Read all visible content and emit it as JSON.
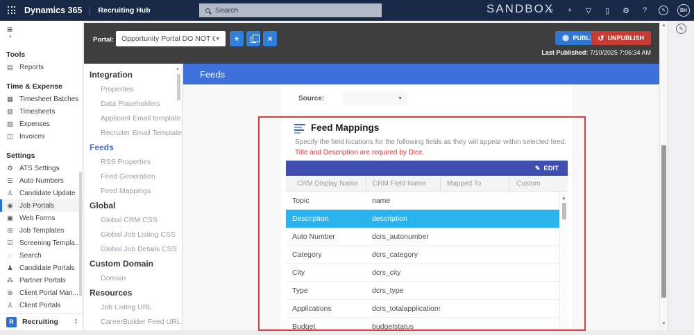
{
  "topbar": {
    "brand": "Dynamics 365",
    "app_name": "Recruiting Hub",
    "search_placeholder": "Search",
    "environment": "SANDBOX",
    "avatar_initials": "BH",
    "icons": [
      {
        "name": "lightbulb-icon",
        "glyph": "☼"
      },
      {
        "name": "add-icon",
        "glyph": "+"
      },
      {
        "name": "filter-icon",
        "glyph": "▽"
      },
      {
        "name": "device-icon",
        "glyph": "▯"
      },
      {
        "name": "gear-icon",
        "glyph": "⚙"
      },
      {
        "name": "help-icon",
        "glyph": "?"
      }
    ]
  },
  "sidebar": {
    "sections": [
      {
        "title": "Tools",
        "items": [
          {
            "label": "Reports",
            "icon": "reports-icon",
            "glyph": "▤",
            "selected": false
          }
        ]
      },
      {
        "title": "Time & Expense",
        "items": [
          {
            "label": "Timesheet Batches",
            "icon": "timesheet-batches-icon",
            "glyph": "▦",
            "selected": false
          },
          {
            "label": "Timesheets",
            "icon": "timesheets-icon",
            "glyph": "▥",
            "selected": false
          },
          {
            "label": "Expenses",
            "icon": "expenses-icon",
            "glyph": "▨",
            "selected": false
          },
          {
            "label": "Invoices",
            "icon": "invoices-icon",
            "glyph": "◫",
            "selected": false
          }
        ]
      },
      {
        "title": "Settings",
        "items": [
          {
            "label": "ATS Settings",
            "icon": "gear-icon",
            "glyph": "⚙",
            "selected": false
          },
          {
            "label": "Auto Numbers",
            "icon": "numbered-list-icon",
            "glyph": "☰",
            "selected": false
          },
          {
            "label": "Candidate Update",
            "icon": "person-icon",
            "glyph": "♙",
            "selected": false
          },
          {
            "label": "Job Portals",
            "icon": "globe-icon",
            "glyph": "◉",
            "selected": true
          },
          {
            "label": "Web Forms",
            "icon": "form-icon",
            "glyph": "▣",
            "selected": false
          },
          {
            "label": "Job Templates",
            "icon": "template-icon",
            "glyph": "⊞",
            "selected": false
          },
          {
            "label": "Screening Templa...",
            "icon": "checklist-icon",
            "glyph": "☑",
            "selected": false
          },
          {
            "label": "Search",
            "icon": "search-icon",
            "glyph": "◌",
            "selected": false
          },
          {
            "label": "Candidate Portals",
            "icon": "people-icon",
            "glyph": "♟",
            "selected": false
          },
          {
            "label": "Partner Portals",
            "icon": "group-icon",
            "glyph": "⁂",
            "selected": false
          },
          {
            "label": "Client Portal Man...",
            "icon": "portal-manager-icon",
            "glyph": "⊕",
            "selected": false
          },
          {
            "label": "Client Portals",
            "icon": "person-icon",
            "glyph": "♙",
            "selected": false
          }
        ]
      }
    ],
    "footer": {
      "badge": "R",
      "label": "Recruiting"
    }
  },
  "portalbar": {
    "portal_label": "Portal:",
    "portal_value": "Opportunity Portal DO NOT Change",
    "publish_label": "PUBLISH",
    "unpublish_label": "UNPUBLISH",
    "last_published_label": "Last Published:",
    "last_published_value": "7/10/2025 7:06:34 AM"
  },
  "subnav": {
    "sections": [
      {
        "title": "Integration",
        "active": false,
        "items": [
          "Properties",
          "Data Placeholders",
          "Applicant Email template",
          "Recruiter Email Template"
        ]
      },
      {
        "title": "Feeds",
        "active": true,
        "items": [
          "RSS Properties",
          "Feed Generation",
          "Feed Mappings"
        ]
      },
      {
        "title": "Global",
        "active": false,
        "items": [
          "Global CRM CSS",
          "Global Job Listing CSS",
          "Global Job Details CSS"
        ]
      },
      {
        "title": "Custom Domain",
        "active": false,
        "items": [
          "Domain"
        ]
      },
      {
        "title": "Resources",
        "active": false,
        "items": [
          "Job Listing URL",
          "CareerBuilder Feed URL"
        ]
      }
    ]
  },
  "main": {
    "page_title": "Feeds",
    "source_label": "Source:",
    "source_value": "",
    "feed_mappings": {
      "title": "Feed Mappings",
      "description": "Specify the field locations for the following fields as they will appear within selected feed.",
      "warning": "Title and Description are required by Dice.",
      "edit_label": "EDIT",
      "columns": [
        "CRM Display Name",
        "CRM Field Name",
        "Mapped To",
        "Custom"
      ],
      "rows": [
        {
          "display": "Topic",
          "field": "name",
          "mapped": "",
          "custom": "",
          "selected": false
        },
        {
          "display": "Description",
          "field": "description",
          "mapped": "",
          "custom": "",
          "selected": true
        },
        {
          "display": "Auto Number",
          "field": "dcrs_autonumber",
          "mapped": "",
          "custom": "",
          "selected": false
        },
        {
          "display": "Category",
          "field": "dcrs_category",
          "mapped": "",
          "custom": "",
          "selected": false
        },
        {
          "display": "City",
          "field": "dcrs_city",
          "mapped": "",
          "custom": "",
          "selected": false
        },
        {
          "display": "Type",
          "field": "dcrs_type",
          "mapped": "",
          "custom": "",
          "selected": false
        },
        {
          "display": "Applications",
          "field": "dcrs_totalapplications",
          "mapped": "",
          "custom": "",
          "selected": false
        },
        {
          "display": "Budget",
          "field": "budgetstatus",
          "mapped": "",
          "custom": "",
          "selected": false
        }
      ]
    }
  },
  "colors": {
    "topbar_navy": "#182947",
    "toolbar_charcoal": "#3e3e3e",
    "feeds_bar_blue": "#3e70da",
    "grid_toolbar_indigo": "#3e4eb0",
    "selected_row_cyan": "#29b4f0",
    "publish_blue": "#2e77d4",
    "unpublish_red": "#c93a32",
    "annotation_red": "#e23b3b",
    "active_nav_blue": "#3f6ad8"
  }
}
